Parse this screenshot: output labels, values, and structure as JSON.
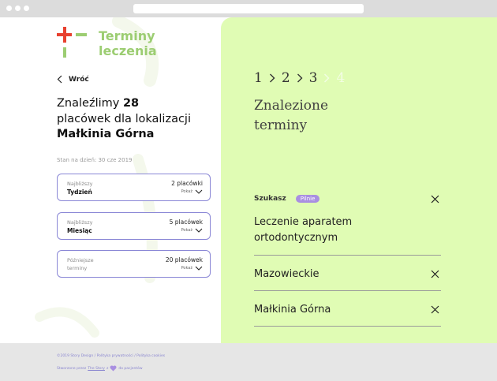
{
  "brand": {
    "line1": "Terminy",
    "line2": "leczenia",
    "color": "#9ccd72",
    "cross_color": "#e8412f"
  },
  "back": {
    "label": "Wróć"
  },
  "headline": {
    "prefix": "Znaleźlimy ",
    "count": "28",
    "middle": "placówek dla lokalizacji",
    "location": "Małkinia Górna"
  },
  "stan": "Stan na dzień: 30 cze 2019",
  "cards": [
    {
      "label_top": "Najbliższy",
      "label_main": "Tydzień",
      "count": "2 placówki",
      "action": "Pokaż"
    },
    {
      "label_top": "Najbliższy",
      "label_main": "Miesiąc",
      "count": "5 placówek",
      "action": "Pokaż"
    },
    {
      "label_top": "Późniejsze",
      "label_main": "terminy",
      "count": "20 placówek",
      "action": "Pokaż"
    }
  ],
  "steps": [
    "1",
    "2",
    "3",
    "4"
  ],
  "title": {
    "line1": "Znalezione",
    "line2": "terminy"
  },
  "search": {
    "label": "Szukasz",
    "badge": "Pilnie",
    "treatment_line1": "Leczenie aparatem",
    "treatment_line2": "ortodontycznym",
    "region": "Mazowieckie",
    "city": "Małkinia Górna"
  },
  "footer": {
    "line1": "©2019 Story Design / Polityka prywatności / Polityka cookies",
    "line2_prefix": "Stworzone przez",
    "line2_link": "The Story",
    "line2_mid": "z",
    "line2_suffix": "do pacjentów"
  },
  "colors": {
    "panel": "#e0fcb4",
    "card_border": "#8a87d6",
    "badge": "#a98fe1",
    "footer_text": "#8a86d0"
  }
}
